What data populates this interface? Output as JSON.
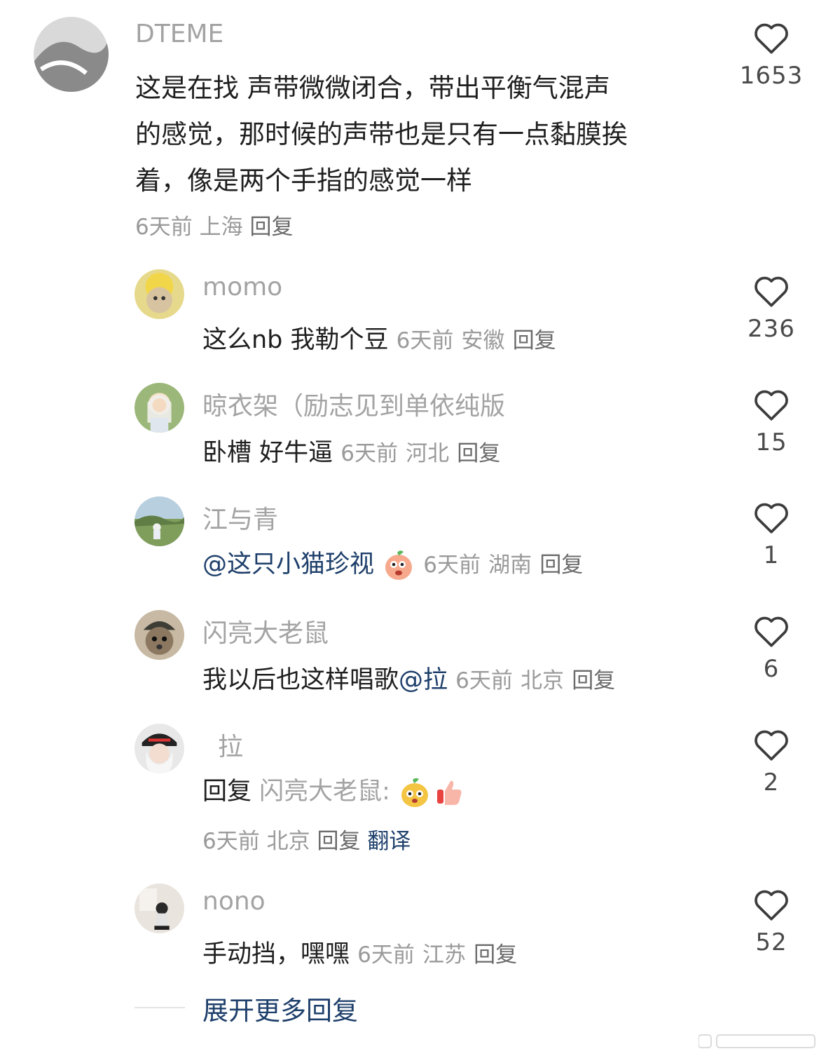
{
  "comments": [
    {
      "username": "DTEME",
      "text": "这是在找 声带微微闭合，带出平衡气混声",
      "text2": "的感觉，那时候的声带也是只有一点黏膜挨",
      "text3": "着，像是两个手指的感觉一样",
      "time": "6天前",
      "location": "上海",
      "reply": "回复",
      "likes": "1653"
    }
  ],
  "replies": [
    {
      "username": "momo",
      "text": "这么nb 我勒个豆",
      "time": "6天前",
      "location": "安徽",
      "reply": "回复",
      "likes": "236"
    },
    {
      "username": "晾衣架（励志见到单依纯版",
      "text": "卧槽 好牛逼",
      "time": "6天前",
      "location": "河北",
      "reply": "回复",
      "likes": "15"
    },
    {
      "username": "江与青",
      "mention": "@这只小猫珍视",
      "time": "6天前",
      "location": "湖南",
      "reply": "回复",
      "likes": "1"
    },
    {
      "username": "闪亮大老鼠",
      "text": "我以后也这样唱歌",
      "mention": "@拉",
      "time": "6天前",
      "location": "北京",
      "reply": "回复",
      "likes": "6"
    },
    {
      "username": "拉",
      "prefix": "回复",
      "reply_to": "闪亮大老鼠:",
      "time": "6天前",
      "location": "北京",
      "reply": "回复",
      "translate": "翻译",
      "likes": "2"
    },
    {
      "username": "nono",
      "text": "手动挡，嘿嘿",
      "time": "6天前",
      "location": "江苏",
      "reply": "回复",
      "likes": "52"
    }
  ],
  "expand_more": "展开更多回复",
  "colors": {
    "meta": "#9a9a9a",
    "mention": "#1e3f6b",
    "username": "#a3a3a3"
  }
}
